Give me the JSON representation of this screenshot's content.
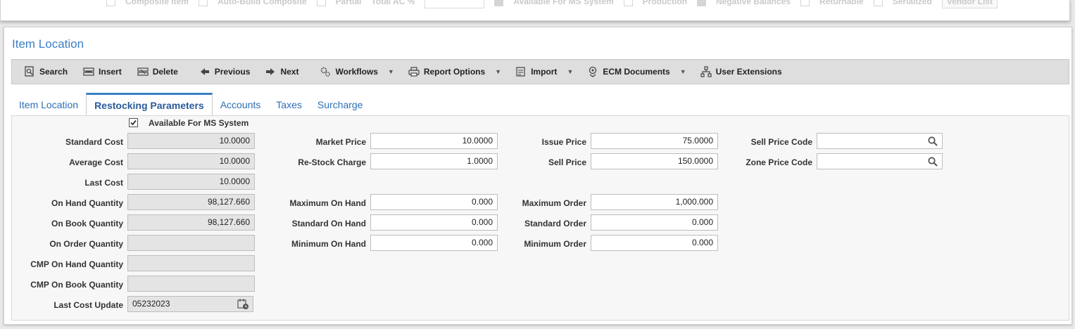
{
  "background_strip": {
    "items": [
      "Composite Item",
      "Auto-Build Composite",
      "Partial",
      "Total AC %",
      "Available For MS System",
      "Production",
      "Negative Balances",
      "Returnable",
      "Serialized"
    ],
    "button": "Vendor List"
  },
  "panel_title": "Item Location",
  "toolbar": {
    "search": "Search",
    "insert": "Insert",
    "delete": "Delete",
    "previous": "Previous",
    "next": "Next",
    "workflows": "Workflows",
    "report_options": "Report Options",
    "import": "Import",
    "ecm_documents": "ECM Documents",
    "user_extensions": "User Extensions"
  },
  "tabs": [
    "Item Location",
    "Restocking Parameters",
    "Accounts",
    "Taxes",
    "Surcharge"
  ],
  "active_tab": "Restocking Parameters",
  "form": {
    "available_for_ms": {
      "label": "Available For MS System",
      "checked": true
    },
    "standard_cost": {
      "label": "Standard Cost",
      "value": "10.0000"
    },
    "average_cost": {
      "label": "Average Cost",
      "value": "10.0000"
    },
    "last_cost": {
      "label": "Last Cost",
      "value": "10.0000"
    },
    "on_hand_qty": {
      "label": "On Hand Quantity",
      "value": "98,127.660"
    },
    "on_book_qty": {
      "label": "On Book Quantity",
      "value": "98,127.660"
    },
    "on_order_qty": {
      "label": "On Order Quantity",
      "value": ""
    },
    "cmp_on_hand_qty": {
      "label": "CMP On Hand Quantity",
      "value": ""
    },
    "cmp_on_book_qty": {
      "label": "CMP On Book Quantity",
      "value": ""
    },
    "last_cost_update": {
      "label": "Last Cost Update",
      "value": "05232023"
    },
    "market_price": {
      "label": "Market Price",
      "value": "10.0000"
    },
    "restock_charge": {
      "label": "Re-Stock Charge",
      "value": "1.0000"
    },
    "maximum_on_hand": {
      "label": "Maximum On Hand",
      "value": "0.000"
    },
    "standard_on_hand": {
      "label": "Standard On Hand",
      "value": "0.000"
    },
    "minimum_on_hand": {
      "label": "Minimum On Hand",
      "value": "0.000"
    },
    "issue_price": {
      "label": "Issue Price",
      "value": "75.0000"
    },
    "sell_price": {
      "label": "Sell Price",
      "value": "150.0000"
    },
    "maximum_order": {
      "label": "Maximum Order",
      "value": "1,000.000"
    },
    "standard_order": {
      "label": "Standard Order",
      "value": "0.000"
    },
    "minimum_order": {
      "label": "Minimum Order",
      "value": "0.000"
    },
    "sell_price_code": {
      "label": "Sell Price Code",
      "value": ""
    },
    "zone_price_code": {
      "label": "Zone Price Code",
      "value": ""
    }
  }
}
